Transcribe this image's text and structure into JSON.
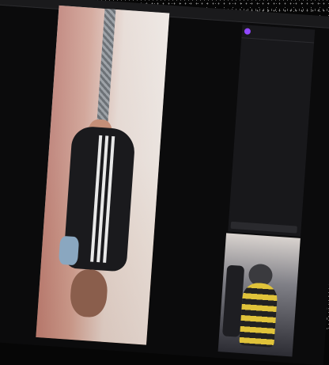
{
  "chat": {
    "header_title": "",
    "messages": [
      {
        "user": "",
        "text": "",
        "color": "#ffffff"
      },
      {
        "user": "",
        "text": "",
        "color": "#a7a7a7"
      },
      {
        "user": "",
        "text": "",
        "color": "#b07bff"
      },
      {
        "user": "",
        "text": "",
        "color": "#ffffff"
      },
      {
        "user": "",
        "text": "",
        "color": "#ff6bd0"
      },
      {
        "user": "",
        "text": "",
        "color": "#ffffff"
      },
      {
        "user": "",
        "text": "",
        "color": "#57d7ff"
      },
      {
        "user": "",
        "text": "",
        "color": "#6dff7a"
      },
      {
        "user": "",
        "text": "",
        "color": "#ff9b4a"
      },
      {
        "user": "",
        "text": "",
        "color": "#57d7ff"
      },
      {
        "user": "",
        "text": "",
        "color": "#c47bff"
      },
      {
        "user": "",
        "text": "",
        "color": "#ff6b6b"
      },
      {
        "user": "",
        "text": "",
        "color": "#ffffff"
      },
      {
        "user": "",
        "text": "",
        "color": "#ff9b4a"
      }
    ]
  },
  "colors": {
    "accent": "#9147ff",
    "chat_bg": "#18181b"
  }
}
